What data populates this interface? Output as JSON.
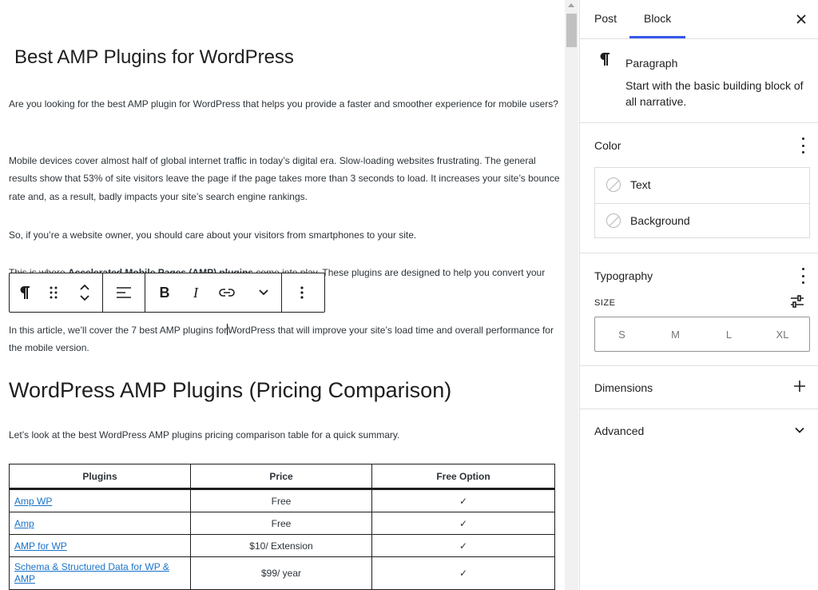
{
  "editor": {
    "title": "Best AMP Plugins for WordPress",
    "para1": "Are you looking for the best AMP plugin for WordPress that helps you provide a faster and smoother experience for mobile users?",
    "para2": "Mobile devices cover almost half of global internet traffic in today’s digital era. Slow-loading websites frustrating. The general results show that 53% of site visitors leave the page if the page takes more than 3 seconds to load. It increases your site’s bounce rate and, as a result, badly impacts your site’s search engine rankings.",
    "para3": "So, if you’re a website owner, you should care about your visitors from smartphones to your site.",
    "para4_start": "This is where ",
    "para4_bold": "Accelerated Mobile Pages (AMP) plugins",
    "para4_end": " come into play. These plugins are designed to help you convert your",
    "para5_before_caret": "In this article, we’ll cover the 7 best AMP plugins for",
    "para5_after_caret": "WordPress that will improve your site’s load time and overall performance for the mobile version.",
    "heading2": "WordPress AMP Plugins (Pricing Comparison)",
    "para6": "Let’s look at the best WordPress AMP plugins pricing comparison table for a quick summary.",
    "table": {
      "headers": [
        "Plugins",
        "Price",
        "Free Option"
      ],
      "rows": [
        {
          "plugin": "Amp WP",
          "price": "Free",
          "free": "✓"
        },
        {
          "plugin": "Amp",
          "price": "Free",
          "free": "✓"
        },
        {
          "plugin": "AMP for WP",
          "price": "$10/ Extension",
          "free": "✓"
        },
        {
          "plugin": "Schema & Structured Data for WP & AMP",
          "price": "$99/ year",
          "free": "✓"
        }
      ]
    }
  },
  "toolbar": {
    "icons": [
      "paragraph-icon",
      "drag-handle-icon",
      "move-up-down-icon",
      "align-icon",
      "bold-icon",
      "italic-icon",
      "link-icon",
      "more-rich-text-icon",
      "options-icon"
    ],
    "bold_label": "B",
    "italic_label": "I"
  },
  "sidebar": {
    "tabs": [
      "Post",
      "Block"
    ],
    "active_tab": "Block",
    "accent_color": "#3858e9",
    "block": {
      "name": "Paragraph",
      "description": "Start with the basic building block of all narrative."
    },
    "color": {
      "title": "Color",
      "items": [
        "Text",
        "Background"
      ]
    },
    "typography": {
      "title": "Typography",
      "size_label": "SIZE",
      "sizes": [
        "S",
        "M",
        "L",
        "XL"
      ]
    },
    "dimensions": {
      "title": "Dimensions"
    },
    "advanced": {
      "title": "Advanced"
    }
  }
}
